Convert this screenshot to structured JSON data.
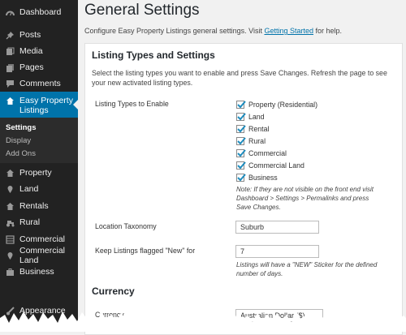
{
  "sidebar": {
    "items_top": [
      {
        "label": "Dashboard",
        "icon": "dashboard-icon"
      },
      {
        "label": "Posts",
        "icon": "pushpin-icon"
      },
      {
        "label": "Media",
        "icon": "media-icon"
      },
      {
        "label": "Pages",
        "icon": "pages-icon"
      },
      {
        "label": "Comments",
        "icon": "comment-icon"
      }
    ],
    "active": {
      "label_line1": "Easy Property",
      "label_line2": "Listings",
      "icon": "house-icon"
    },
    "submenu": [
      "Settings",
      "Display",
      "Add Ons"
    ],
    "items_bottom": [
      {
        "label": "Property",
        "icon": "house-icon"
      },
      {
        "label": "Land",
        "icon": "map-pin-icon"
      },
      {
        "label": "Rentals",
        "icon": "house-icon"
      },
      {
        "label": "Rural",
        "icon": "tractor-icon"
      },
      {
        "label": "Commercial",
        "icon": "building-icon"
      },
      {
        "label": "Commercial Land",
        "icon": "map-pin-icon"
      },
      {
        "label": "Business",
        "icon": "briefcase-icon"
      },
      {
        "label": "Appearance",
        "icon": "brush-icon"
      }
    ]
  },
  "page": {
    "title": "General Settings",
    "intro_before": "Configure Easy Property Listings general settings. Visit ",
    "intro_link": "Getting Started",
    "intro_after": " for help."
  },
  "listing_types": {
    "heading": "Listing Types and Settings",
    "description": "Select the listing types you want to enable and press Save Changes. Refresh the page to see your new activated listing types.",
    "label": "Listing Types to Enable",
    "options": [
      {
        "label": "Property (Residential)",
        "checked": true
      },
      {
        "label": "Land",
        "checked": true
      },
      {
        "label": "Rental",
        "checked": true
      },
      {
        "label": "Rural",
        "checked": true
      },
      {
        "label": "Commercial",
        "checked": true
      },
      {
        "label": "Commercial Land",
        "checked": true
      },
      {
        "label": "Business",
        "checked": true
      }
    ],
    "note_line1": "Note: If they are not visible on the front end visit",
    "note_line2": "Dashboard > Settings > Permalinks and press",
    "note_line3": "Save Changes."
  },
  "location_taxonomy": {
    "label": "Location Taxonomy",
    "value": "Suburb"
  },
  "new_flag": {
    "label": "Keep Listings flagged \"New\" for",
    "value": "7",
    "help_line1": "Listings will have a \"NEW\" Sticker for the defined",
    "help_line2": "number of days."
  },
  "currency": {
    "heading": "Currency",
    "label": "Currency",
    "value": "Australian Dollar ($)"
  },
  "colors": {
    "sidebar": "#222222",
    "active": "#0073aa",
    "link": "#0073aa"
  }
}
